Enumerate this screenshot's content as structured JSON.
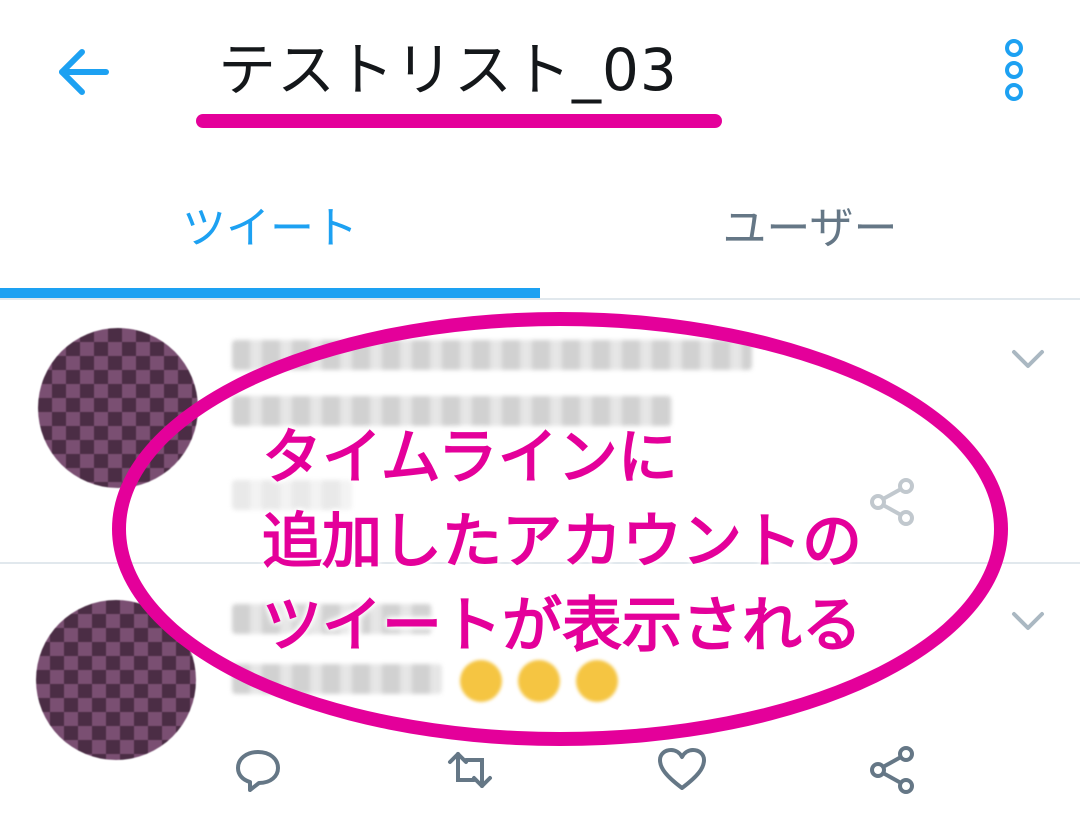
{
  "appbar": {
    "title": "テストリスト_03"
  },
  "tabs": [
    {
      "label": "ツイート"
    },
    {
      "label": "ユーザー"
    }
  ],
  "annotation": {
    "lines": [
      "タイムラインに",
      "追加したアカウントの",
      "ツイートが表示される"
    ]
  },
  "icons": {
    "back": "arrow-left-icon",
    "more": "more-vertical-icon",
    "chevron": "chevron-down-icon",
    "reply": "reply-icon",
    "retweet": "retweet-icon",
    "like": "heart-icon",
    "share": "share-icon"
  },
  "colors": {
    "accent": "#1da1f2",
    "annotation": "#e4009a",
    "muted": "#657786"
  }
}
